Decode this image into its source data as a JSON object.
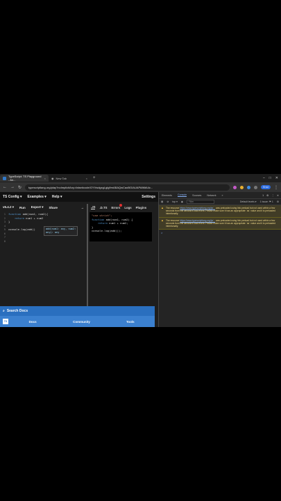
{
  "browser": {
    "tabs": [
      {
        "title": "TypeScript: TS Playground - An...",
        "active": true
      },
      {
        "title": "New Tab",
        "active": false
      }
    ],
    "new_tab": "+",
    "window_controls": [
      "–",
      "□",
      "✕"
    ],
    "url": "typescriptlang.org/play?noImplicitAny=false#code/GYVwdgxgLglg9mABAQwCaoBGIAUAPAfMtA4c...",
    "profile_label": "Error"
  },
  "playground": {
    "header": {
      "ts_config": "TS Config ▾",
      "examples": "Examples ▾",
      "help": "Help ▾",
      "settings": "Settings"
    },
    "toolbar": {
      "version": "v5.4.2 ▾",
      "run": "Run",
      "export": "Export ▾",
      "share": "Share",
      "arrow": "→"
    },
    "editor_lines": [
      {
        "n": "1",
        "kw": "function ",
        "code": "add(num1, num2){"
      },
      {
        "n": "2",
        "kw": "    return ",
        "code": "num1 + num2"
      },
      {
        "n": "3",
        "kw": "",
        "code": "}"
      },
      {
        "n": "4",
        "kw": "",
        "code": ""
      },
      {
        "n": "5",
        "kw": "",
        "code": "console.log(add()"
      },
      {
        "n": "6",
        "kw": "",
        "code": ""
      },
      {
        "n": "7",
        "kw": "",
        "code": ""
      },
      {
        "n": "8",
        "kw": "",
        "code": ""
      }
    ],
    "tooltip": {
      "line1": "add(num1: any, num2:",
      "line2": "any): any"
    },
    "output_tabs": [
      {
        "label": ".JS",
        "selected": true
      },
      {
        "label": ".D.TS",
        "selected": false
      },
      {
        "label": "Errors",
        "selected": false,
        "badge": true
      },
      {
        "label": "Logs",
        "selected": false
      },
      {
        "label": "Plugins",
        "selected": false
      }
    ],
    "output_lines": [
      {
        "kw": "",
        "str": "\"use strict\";",
        "code": ""
      },
      {
        "kw": "function ",
        "str": "",
        "code": "add(num1, num2) {"
      },
      {
        "kw": "    return ",
        "str": "",
        "code": "num1 + num2;"
      },
      {
        "kw": "",
        "str": "",
        "code": "}"
      },
      {
        "kw": "",
        "str": "",
        "code": "console.log(add());"
      }
    ],
    "search_docs": "Search Docs",
    "footer": {
      "logo": "TS",
      "links": [
        "Docs",
        "Community",
        "Tools"
      ]
    }
  },
  "devtools": {
    "tabs": [
      "Elements",
      "Console",
      "Sources",
      "Network",
      "»"
    ],
    "selected_tab": "Console",
    "issues": "1",
    "filter": {
      "context": "top ▾",
      "placeholder": "Filter",
      "levels": "Default levels ▾",
      "issues": "1 Issue: ⚑ 1",
      "gear": "⚙"
    },
    "messages": [
      {
        "pre": "The resource ",
        "url": "https://www.typescriptlang.org/js/...",
        "post": " was preloaded using link preload but not used within a few seconds from the window's load event. Please make sure it has an appropriate `as` value and it is preloaded intentionally."
      },
      {
        "pre": "The resource ",
        "url": "https://www.typescriptlang.org/js/...",
        "post": " was preloaded using link preload but not used within a few seconds from the window's load event. Please make sure it has an appropriate `as` value and it is preloaded intentionally."
      }
    ],
    "prompt": ">"
  },
  "colors": {
    "accent": "#2a6fbf",
    "footer": "#3b80cf",
    "warning_bg": "#413c26",
    "keyword": "#569cd6",
    "string": "#ce9178"
  }
}
